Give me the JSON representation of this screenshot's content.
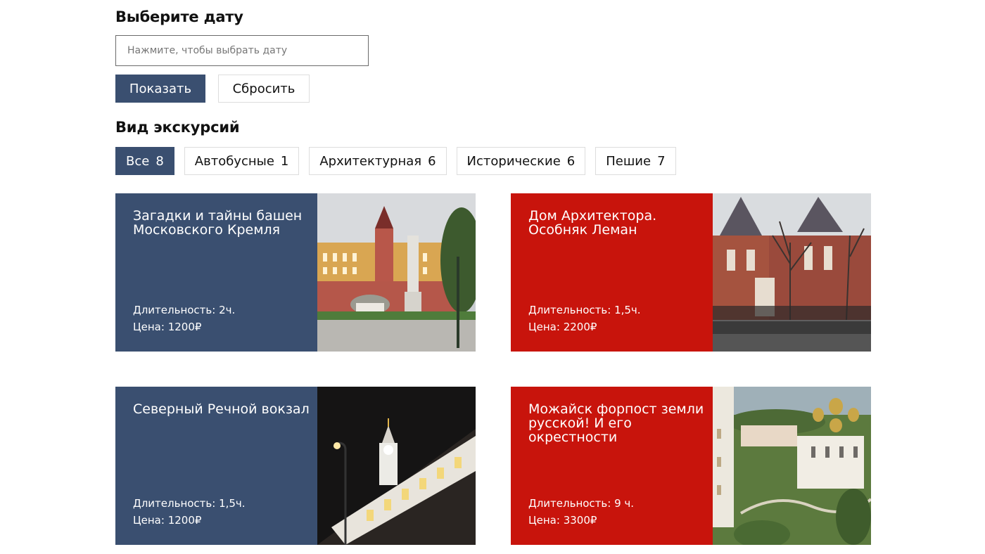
{
  "date_section": {
    "title": "Выберите дату",
    "placeholder": "Нажмите, чтобы выбрать дату",
    "show_label": "Показать",
    "reset_label": "Сбросить"
  },
  "type_section": {
    "title": "Вид экскурсий",
    "filters": [
      {
        "label": "Все",
        "count": "8"
      },
      {
        "label": "Автобусные",
        "count": "1"
      },
      {
        "label": "Архитектурная",
        "count": "6"
      },
      {
        "label": "Исторические",
        "count": "6"
      },
      {
        "label": "Пешие",
        "count": "7"
      }
    ]
  },
  "tours": [
    {
      "title": "Загадки и тайны башен Московского Кремля",
      "duration": "Длительность: 2ч.",
      "price": "Цена: 1200₽",
      "color": "#3a4f70"
    },
    {
      "title": "Дом Архитектора. Особняк Леман",
      "duration": "Длительность: 1,5ч.",
      "price": "Цена: 2200₽",
      "color": "#c8140c"
    },
    {
      "title": "Северный Речной вокзал",
      "duration": "Длительность: 1,5ч.",
      "price": "Цена: 1200₽",
      "color": "#3a4f70"
    },
    {
      "title": "Можайск форпост земли русской! И его окрестности",
      "duration": "Длительность: 9 ч.",
      "price": "Цена: 3300₽",
      "color": "#c8140c"
    }
  ]
}
